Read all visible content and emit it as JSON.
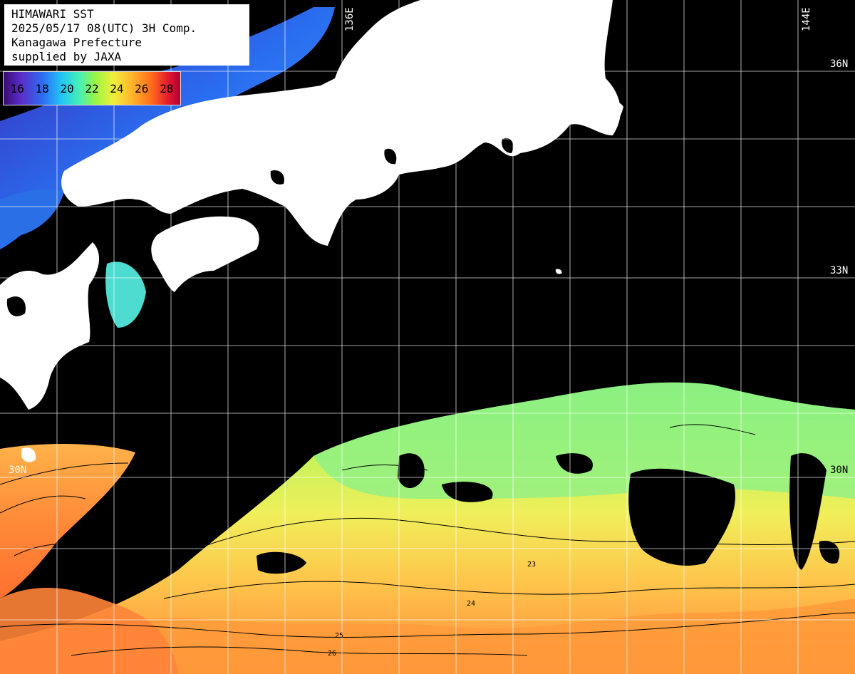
{
  "title_lines": [
    "HIMAWARI SST",
    "2025/05/17 08(UTC) 3H Comp.",
    "Kanagawa Prefecture",
    "supplied by JAXA"
  ],
  "legend": {
    "labels": [
      "16",
      "18",
      "20",
      "22",
      "24",
      "26",
      "28"
    ]
  },
  "grid_labels": {
    "lon_136": "136E",
    "lon_144": "144E",
    "lat_36": "36N",
    "lat_33": "33N",
    "lat_30": "30N",
    "lat_30_right": "30N"
  },
  "contour_labels": [
    "23",
    "24",
    "25",
    "26"
  ],
  "colors": {
    "land": "#ffffff",
    "no_data": "#000000",
    "grid": "#ffffff",
    "contour": "#000000"
  }
}
